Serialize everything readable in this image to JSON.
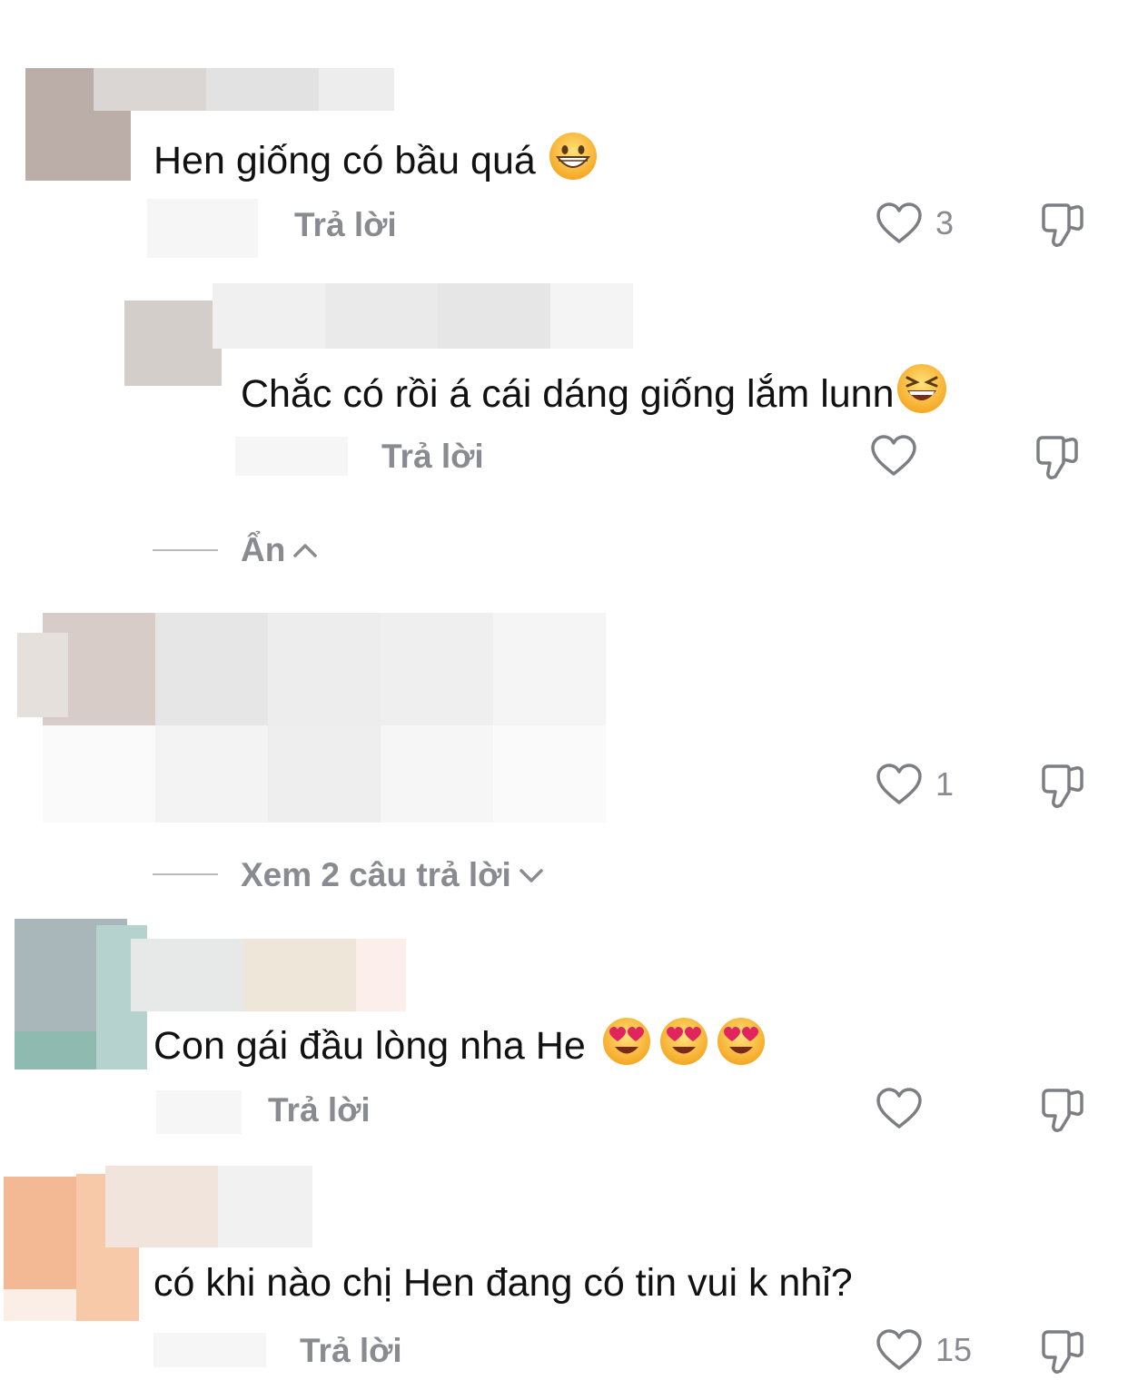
{
  "comments": [
    {
      "text": "Hen giống có bầu quá",
      "emoji": [
        "grinning-face"
      ],
      "reply_label": "Trả lời",
      "likes": "3"
    },
    {
      "text": "Chắc có rồi á cái dáng giống lắm lunn",
      "emoji": [
        "laughing-face"
      ],
      "reply_label": "Trả lời",
      "likes": ""
    },
    {
      "text": "",
      "reply_label": "",
      "likes": "1"
    },
    {
      "text": "Con gái đầu lòng nha He",
      "emoji": [
        "heart-eyes-face",
        "heart-eyes-face",
        "heart-eyes-face"
      ],
      "reply_label": "Trả lời",
      "likes": ""
    },
    {
      "text": "có khi nào chị Hen đang có tin vui k nhỉ?",
      "reply_label": "Trả lời",
      "likes": "15"
    }
  ],
  "thread_toggles": {
    "hide_label": "Ẩn",
    "view_replies_label": "Xem 2 câu trả lời"
  },
  "colors": {
    "text": "#111111",
    "muted": "#8a8b91"
  }
}
